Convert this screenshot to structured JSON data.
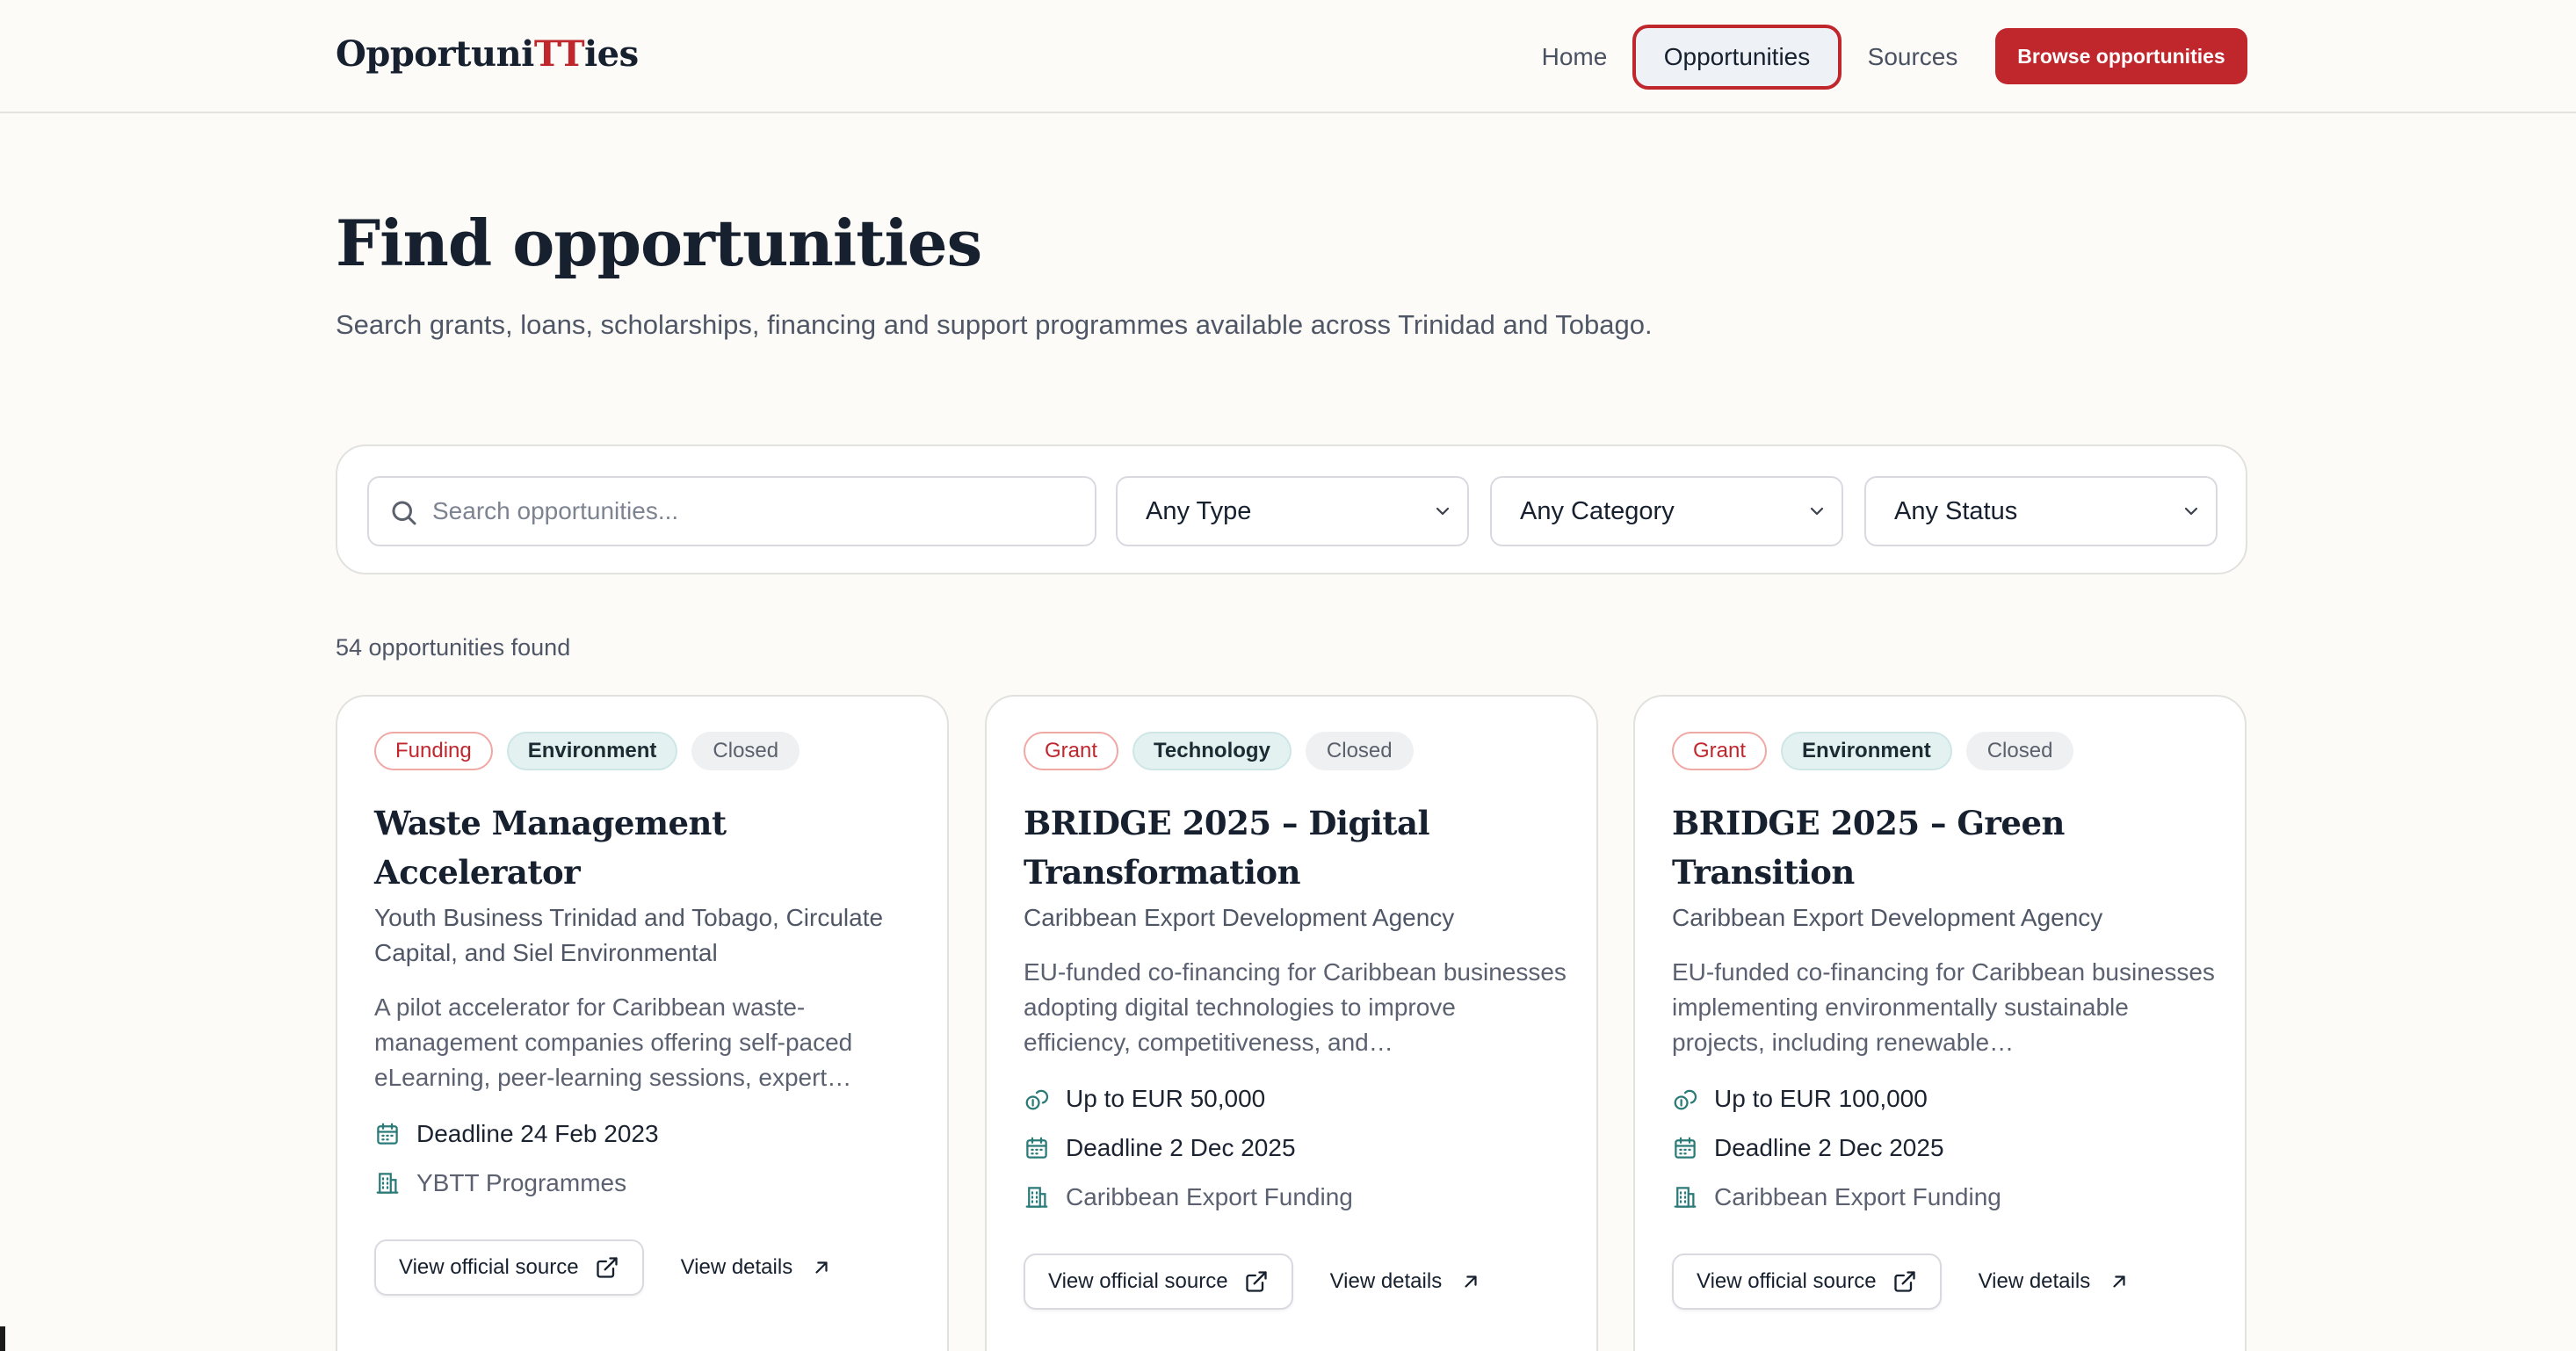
{
  "header": {
    "logo_prefix": "Opportuni",
    "logo_highlight": "TT",
    "logo_suffix": "ies",
    "nav": {
      "home": "Home",
      "opportunities": "Opportunities",
      "sources": "Sources"
    },
    "browse_button": "Browse opportunities"
  },
  "hero": {
    "title": "Find opportunities",
    "subtitle": "Search grants, loans, scholarships, financing and support programmes available across Trinidad and Tobago."
  },
  "filters": {
    "search_placeholder": "Search opportunities...",
    "type": "Any Type",
    "category": "Any Category",
    "status": "Any Status"
  },
  "results_count": "54 opportunities found",
  "cards": [
    {
      "type": "Funding",
      "category": "Environment",
      "status": "Closed",
      "title": "Waste Management Accelerator",
      "organization": "Youth Business Trinidad and Tobago, Circulate Capital, and Siel Environmental",
      "description": "A pilot accelerator for Caribbean waste-management companies offering self-paced eLearning, peer-learning sessions, expert…",
      "amount": "",
      "deadline": "Deadline 24 Feb 2023",
      "programme": "YBTT Programmes",
      "source_label": "View official source",
      "details_label": "View details"
    },
    {
      "type": "Grant",
      "category": "Technology",
      "status": "Closed",
      "title": "BRIDGE 2025 – Digital Transformation",
      "organization": "Caribbean Export Development Agency",
      "description": "EU-funded co-financing for Caribbean businesses adopting digital technologies to improve efficiency, competitiveness, and…",
      "amount": "Up to EUR 50,000",
      "deadline": "Deadline 2 Dec 2025",
      "programme": "Caribbean Export Funding",
      "source_label": "View official source",
      "details_label": "View details"
    },
    {
      "type": "Grant",
      "category": "Environment",
      "status": "Closed",
      "title": "BRIDGE 2025 – Green Transition",
      "organization": "Caribbean Export Development Agency",
      "description": "EU-funded co-financing for Caribbean businesses implementing environmentally sustainable projects, including renewable…",
      "amount": "Up to EUR 100,000",
      "deadline": "Deadline 2 Dec 2025",
      "programme": "Caribbean Export Funding",
      "source_label": "View official source",
      "details_label": "View details"
    }
  ],
  "colors": {
    "brand_red": "#c0272d",
    "teal_icon": "#2a7a78",
    "page_bg": "#fcfbf8"
  }
}
